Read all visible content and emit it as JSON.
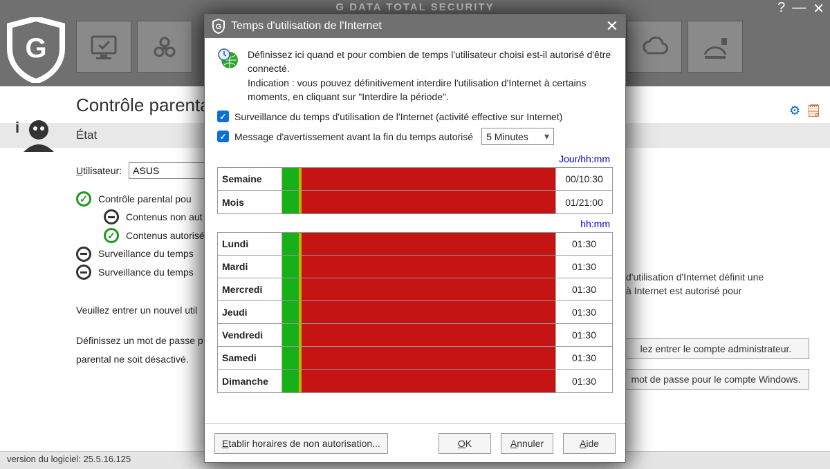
{
  "app": {
    "title": "G DATA TOTAL SECURITY",
    "page_title": "Contrôle parental"
  },
  "section": {
    "title": "État"
  },
  "user": {
    "label": "Utilisateur:",
    "value": "ASUS"
  },
  "options": {
    "parental": "Contrôle parental pou",
    "notallowed": "Contenus non aut",
    "allowed": "Contenus autorisé",
    "time1": "Surveillance du temps",
    "time2": "Surveillance du temps"
  },
  "hints": {
    "right1": "d'utilisation d'Internet définit une",
    "right2": "à Internet est autorisé pour",
    "adminline": "Veuillez entrer un nouvel util",
    "pwline1": "Définissez un mot de passe p",
    "pwline2": "parental ne soit désactivé."
  },
  "buttons": {
    "admin": "lez entrer le compte administrateur.",
    "winpw": "mot de passe pour le compte Windows."
  },
  "footer": {
    "version": "version du logiciel: 25.5.16.125"
  },
  "dialog": {
    "title": "Temps d'utilisation de l'Internet",
    "intro1": "Définissez ici quand et pour combien de temps l'utilisateur choisi est-il autorisé d'être connecté.",
    "intro2": "Indication : vous pouvez définitivement interdire l'utilisation d'Internet à certains moments, en cliquant sur \"Interdire la période\".",
    "check1": "Surveillance du temps d'utilisation de l'Internet (activité effective sur Internet)",
    "check2": "Message d'avertissement avant la fin du temps autorisé",
    "combo": "5 Minutes",
    "unit_week": "Jour/hh:mm",
    "unit_day": "hh:mm",
    "rows_summary": [
      {
        "label": "Semaine",
        "value": "00/10:30"
      },
      {
        "label": "Mois",
        "value": "01/21:00"
      }
    ],
    "rows_days": [
      {
        "label": "Lundi",
        "value": "01:30"
      },
      {
        "label": "Mardi",
        "value": "01:30"
      },
      {
        "label": "Mercredi",
        "value": "01:30"
      },
      {
        "label": "Jeudi",
        "value": "01:30"
      },
      {
        "label": "Vendredi",
        "value": "01:30"
      },
      {
        "label": "Samedi",
        "value": "01:30"
      },
      {
        "label": "Dimanche",
        "value": "01:30"
      }
    ],
    "btn_schedule_pre": "E",
    "btn_schedule": "tablir horaires de non autorisation...",
    "btn_ok_pre": "O",
    "btn_ok": "K",
    "btn_cancel_pre": "A",
    "btn_cancel": "nnuler",
    "btn_help_pre": "A",
    "btn_help": "ide"
  }
}
